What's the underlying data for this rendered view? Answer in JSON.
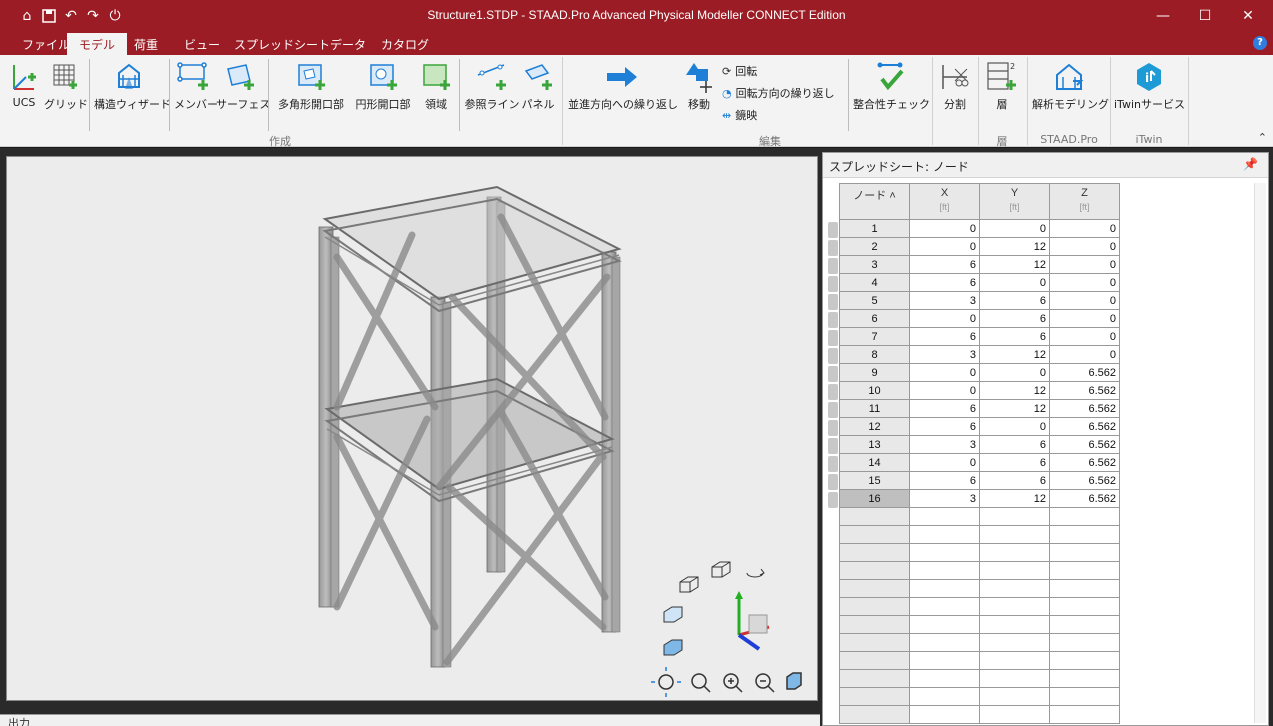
{
  "window": {
    "title": "Structure1.STDP - STAAD.Pro Advanced Physical Modeller CONNECT Edition",
    "minimize": "—",
    "maximize": "☐",
    "close": "✕"
  },
  "menu": {
    "tabs": [
      "ファイル",
      "モデル",
      "荷重",
      "ビュー",
      "スプレッドシート",
      "データ",
      "カタログ"
    ],
    "active_tab": "モデル",
    "help": "?"
  },
  "ribbon": {
    "buttons": {
      "ucs": "UCS",
      "grid": "グリッド",
      "structure_wizard": "構造ウィザード",
      "member": "メンバー",
      "surface": "サーフェス",
      "polygon_opening": "多角形開口部",
      "circular_opening": "円形開口部",
      "region": "領域",
      "reference_line": "参照ライン",
      "panel": "パネル",
      "linear_repeat": "並進方向への繰り返し",
      "move": "移動",
      "rotate": "回転",
      "circular_repeat": "回転方向の繰り返し",
      "mirror": "鏡映",
      "consistency_check": "整合性チェック",
      "split": "分割",
      "level": "層",
      "analytical_modeling": "解析モデリング",
      "itwin_services": "iTwinサービス"
    },
    "groups": {
      "create": "作成",
      "edit": "編集",
      "level": "層",
      "staad": "STAAD.Pro",
      "itwin": "iTwin"
    }
  },
  "spreadsheet": {
    "title": "スプレッドシート: ノード",
    "columns": {
      "node": "ノード",
      "x": "X",
      "y": "Y",
      "z": "Z",
      "unit": "[ft]"
    },
    "rows": [
      [
        "1",
        "0",
        "0",
        "0"
      ],
      [
        "2",
        "0",
        "12",
        "0"
      ],
      [
        "3",
        "6",
        "12",
        "0"
      ],
      [
        "4",
        "6",
        "0",
        "0"
      ],
      [
        "5",
        "3",
        "6",
        "0"
      ],
      [
        "6",
        "0",
        "6",
        "0"
      ],
      [
        "7",
        "6",
        "6",
        "0"
      ],
      [
        "8",
        "3",
        "12",
        "0"
      ],
      [
        "9",
        "0",
        "0",
        "6.562"
      ],
      [
        "10",
        "0",
        "12",
        "6.562"
      ],
      [
        "11",
        "6",
        "12",
        "6.562"
      ],
      [
        "12",
        "6",
        "0",
        "6.562"
      ],
      [
        "13",
        "3",
        "6",
        "6.562"
      ],
      [
        "14",
        "0",
        "6",
        "6.562"
      ],
      [
        "15",
        "6",
        "6",
        "6.562"
      ],
      [
        "16",
        "3",
        "12",
        "6.562"
      ]
    ],
    "selected_row": "16",
    "empty_rows": 12
  },
  "output_panel": {
    "title": "出力"
  },
  "colors": {
    "title_bar": "#9b1c24",
    "ribbon_bg": "#f3f3f3",
    "accent_green": "#3aa53a",
    "accent_blue": "#1e7fd6"
  }
}
